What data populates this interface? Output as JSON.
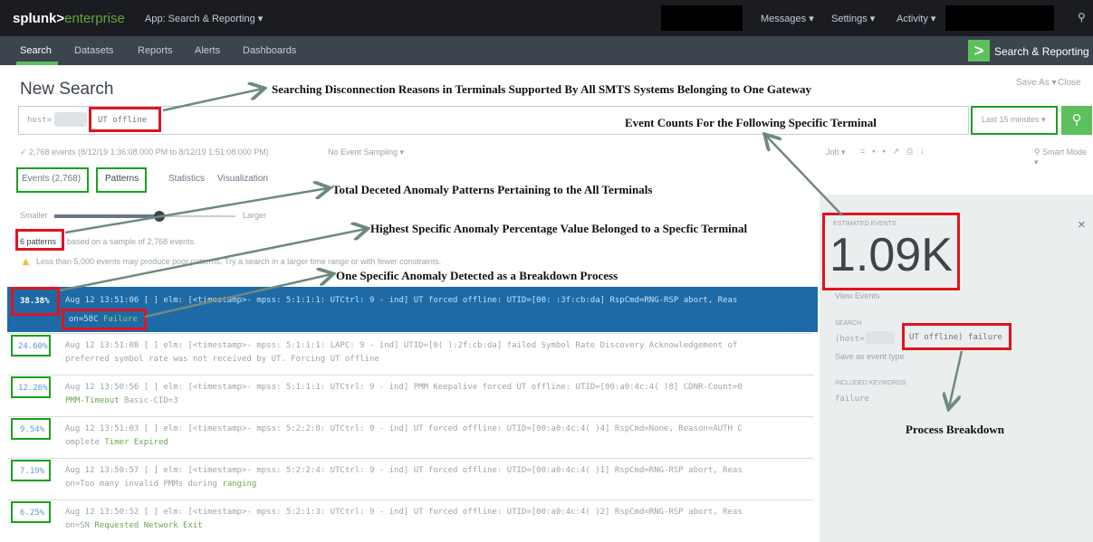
{
  "topbar": {
    "logo_main": "splunk>",
    "logo_sub": "enterprise",
    "app_menu": "App: Search & Reporting ▾",
    "messages": "Messages ▾",
    "settings": "Settings ▾",
    "activity": "Activity ▾"
  },
  "nav": {
    "items": [
      "Search",
      "Datasets",
      "Reports",
      "Alerts",
      "Dashboards"
    ],
    "app_title": "Search & Reporting"
  },
  "page": {
    "title": "New Search",
    "save_as": "Save As ▾",
    "close": "Close"
  },
  "search": {
    "prefix": "host=",
    "query": "UT offline",
    "time_range": "Last 15 minutes ▾"
  },
  "status": {
    "events_line": "✓ 2,768 events (8/12/19 1:36:08.000 PM to 8/12/19 1:51:08.000 PM)",
    "sampling": "No Event Sampling ▾",
    "job": "Job ▾",
    "smart_mode": "⚲ Smart Mode ▾"
  },
  "tabs": [
    "Events (2,768)",
    "Patterns",
    "Statistics",
    "Visualization"
  ],
  "slider": {
    "smaller": "Smaller",
    "larger": "Larger"
  },
  "patterns_info": {
    "count": "6 patterns",
    "rest": "based on a sample of 2,768 events.",
    "warning": "Less than 5,000 events may produce poor patterns. Try a search in a larger time range or with fewer constraints."
  },
  "rows": [
    {
      "pct": "38.38%",
      "line1": "Aug 12 13:51:06 [      ] elm: [<timestamp>- mpss: 5:1:1:1: UTCtrl: 9 - ind] UT forced offline: UTID=[00:     :3f:cb:da] RspCmd=RNG-RSP abort, Reas",
      "line2": "on=58C",
      "line2b": "Failure"
    },
    {
      "pct": "24.60%",
      "line1": "Aug 12 13:51:08 [      ] elm: [<timestamp>- mpss: 5:1:1:1: LAPC: 9 - ind] UTID=[0(    ):2f:cb:da] failed Symbol Rate Discovery Acknowledgement of",
      "line2": "preferred symbol rate was not received by UT. Forcing UT offline",
      "line2b": ""
    },
    {
      "pct": "12.26%",
      "line1": "Aug 12 13:50:56 [      ] elm: [<timestamp>- mpss: 5:1:1:1: UTCtrl: 9 - ind] PMM Keepalive forced UT offline: UTID=[00:a0:4c:4(    )8] CDNR-Count=0",
      "line2": "PMM-Timeout",
      "line2b": "Basic-CID=3"
    },
    {
      "pct": "9.54%",
      "line1": "Aug 12 13:51:03 [      ] elm: [<timestamp>- mpss: 5:2:2:8: UTCtrl: 9 - ind] UT forced offline: UTID=[00:a0:4c:4(    )4] RspCmd=None, Reason=AUTH C",
      "line2": "omplete",
      "line2b": "Timer Expired"
    },
    {
      "pct": "7.19%",
      "line1": "Aug 12 13:50:57 [      ] elm: [<timestamp>- mpss: 5:2:2:4: UTCtrl: 9 - ind] UT forced offline: UTID=[00:a0:4c:4(    )1] RspCmd=RNG-RSP abort, Reas",
      "line2": "on=Too many invalid PMMs during",
      "line2b": "ranging"
    },
    {
      "pct": "6.25%",
      "line1": "Aug 12 13:50:52 [      ] elm: [<timestamp>- mpss: 5:2:1:3: UTCtrl: 9 - ind] UT forced offline: UTID=[00:a0:4c:4(    )2] RspCmd=RNG-RSP abort, Reas",
      "line2": "on=SN",
      "line2b": "Requested Network Exit"
    }
  ],
  "side": {
    "estimated_label": "ESTIMATED EVENTS",
    "estimated_value": "1.09K",
    "view_events": "View Events",
    "search_label": "SEARCH",
    "search_prefix": "(host=",
    "search_value": "UT offline) failure",
    "save_event_type": "Save as event type",
    "keywords_label": "INCLUDED KEYWORDS",
    "keyword": "failure",
    "close": "×"
  },
  "annotations": {
    "a1": "Searching  Disconnection Reasons in Terminals Supported By All SMTS Systems Belonging to One Gateway",
    "a2": "Event Counts For the Following Specific Terminal",
    "a3": "Total Deceted Anomaly Patterns Pertaining to the All Terminals",
    "a4": "Highest Specific Anomaly Percentage Value Belonged to a Specfic Terminal",
    "a5": "One Specific Anomaly Detected as a Breakdown Process",
    "a6": "Process Breakdown"
  },
  "colors": {
    "topbar": "#1a1c21",
    "navbar": "#3c444d",
    "accent_green": "#5cc05c",
    "selected_row": "#1e6aa6",
    "annotation_red": "#e0141e",
    "annotation_green": "#1aa11a",
    "arrow": "#6e8a80"
  }
}
